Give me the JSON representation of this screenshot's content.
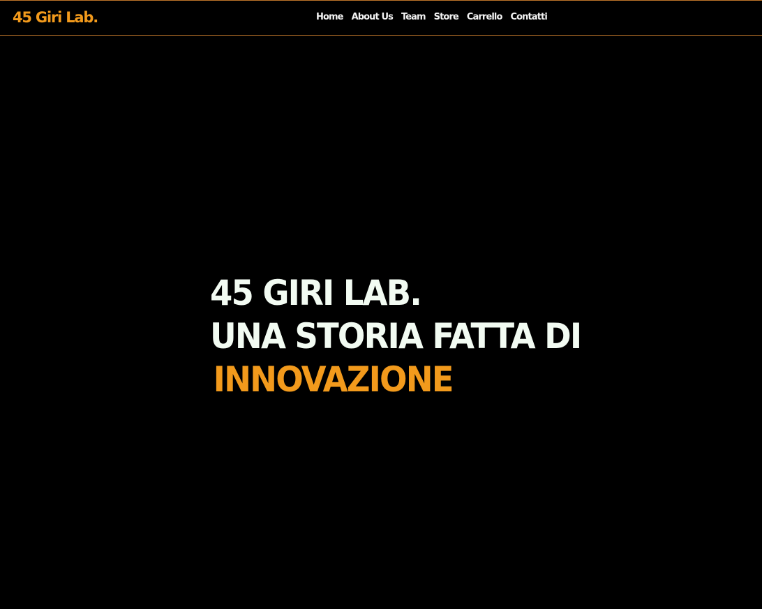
{
  "header": {
    "brand": "45 Giri Lab.",
    "nav": [
      "Home",
      "About Us",
      "Team",
      "Store",
      "Carrello",
      "Contatti"
    ]
  },
  "hero": {
    "line1": "45 GIRI LAB.",
    "line2": "UNA STORIA FATTA DI",
    "highlight": "INNOVAZIONE"
  },
  "colors": {
    "background": "#000000",
    "accent": "#f29a1c",
    "text": "#f2fbf2",
    "border": "#c0762a"
  }
}
